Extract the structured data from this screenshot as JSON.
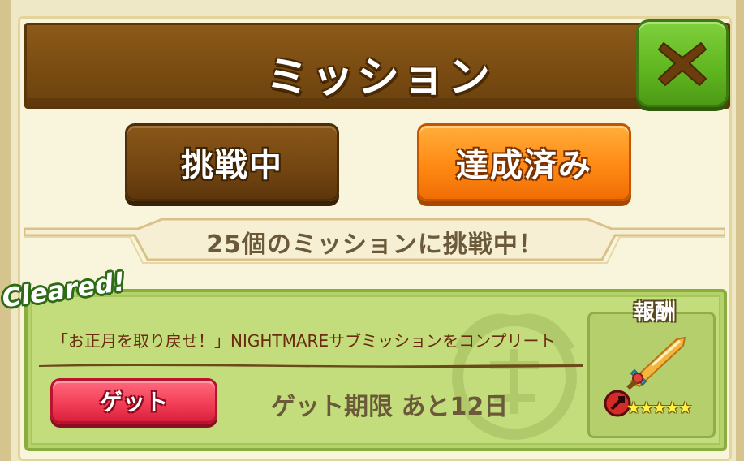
{
  "dialog": {
    "title": "ミッション"
  },
  "tabs": {
    "in_progress": "挑戦中",
    "completed": "達成済み"
  },
  "summary": {
    "text": "25個のミッションに挑戦中！"
  },
  "mission": {
    "badge": "Cleared!",
    "title": "「お正月を取り戻せ！」NIGHTMAREサブミッションをコンプリート",
    "get_button": "ゲット",
    "deadline": "ゲット期限  あと12日",
    "reward": {
      "label": "報酬",
      "item_icon": "sword-icon",
      "element_icon": "fire-element-icon",
      "rarity_stars": "★★★★★",
      "rarity_count": 5
    }
  },
  "colors": {
    "title_bar": "#7a4c12",
    "close_button": "#5fb51f",
    "tab_active": "#6e4210",
    "tab_completed": "#ff8a14",
    "get_button": "#f23c55",
    "card_bg": "#c3dd7c"
  }
}
